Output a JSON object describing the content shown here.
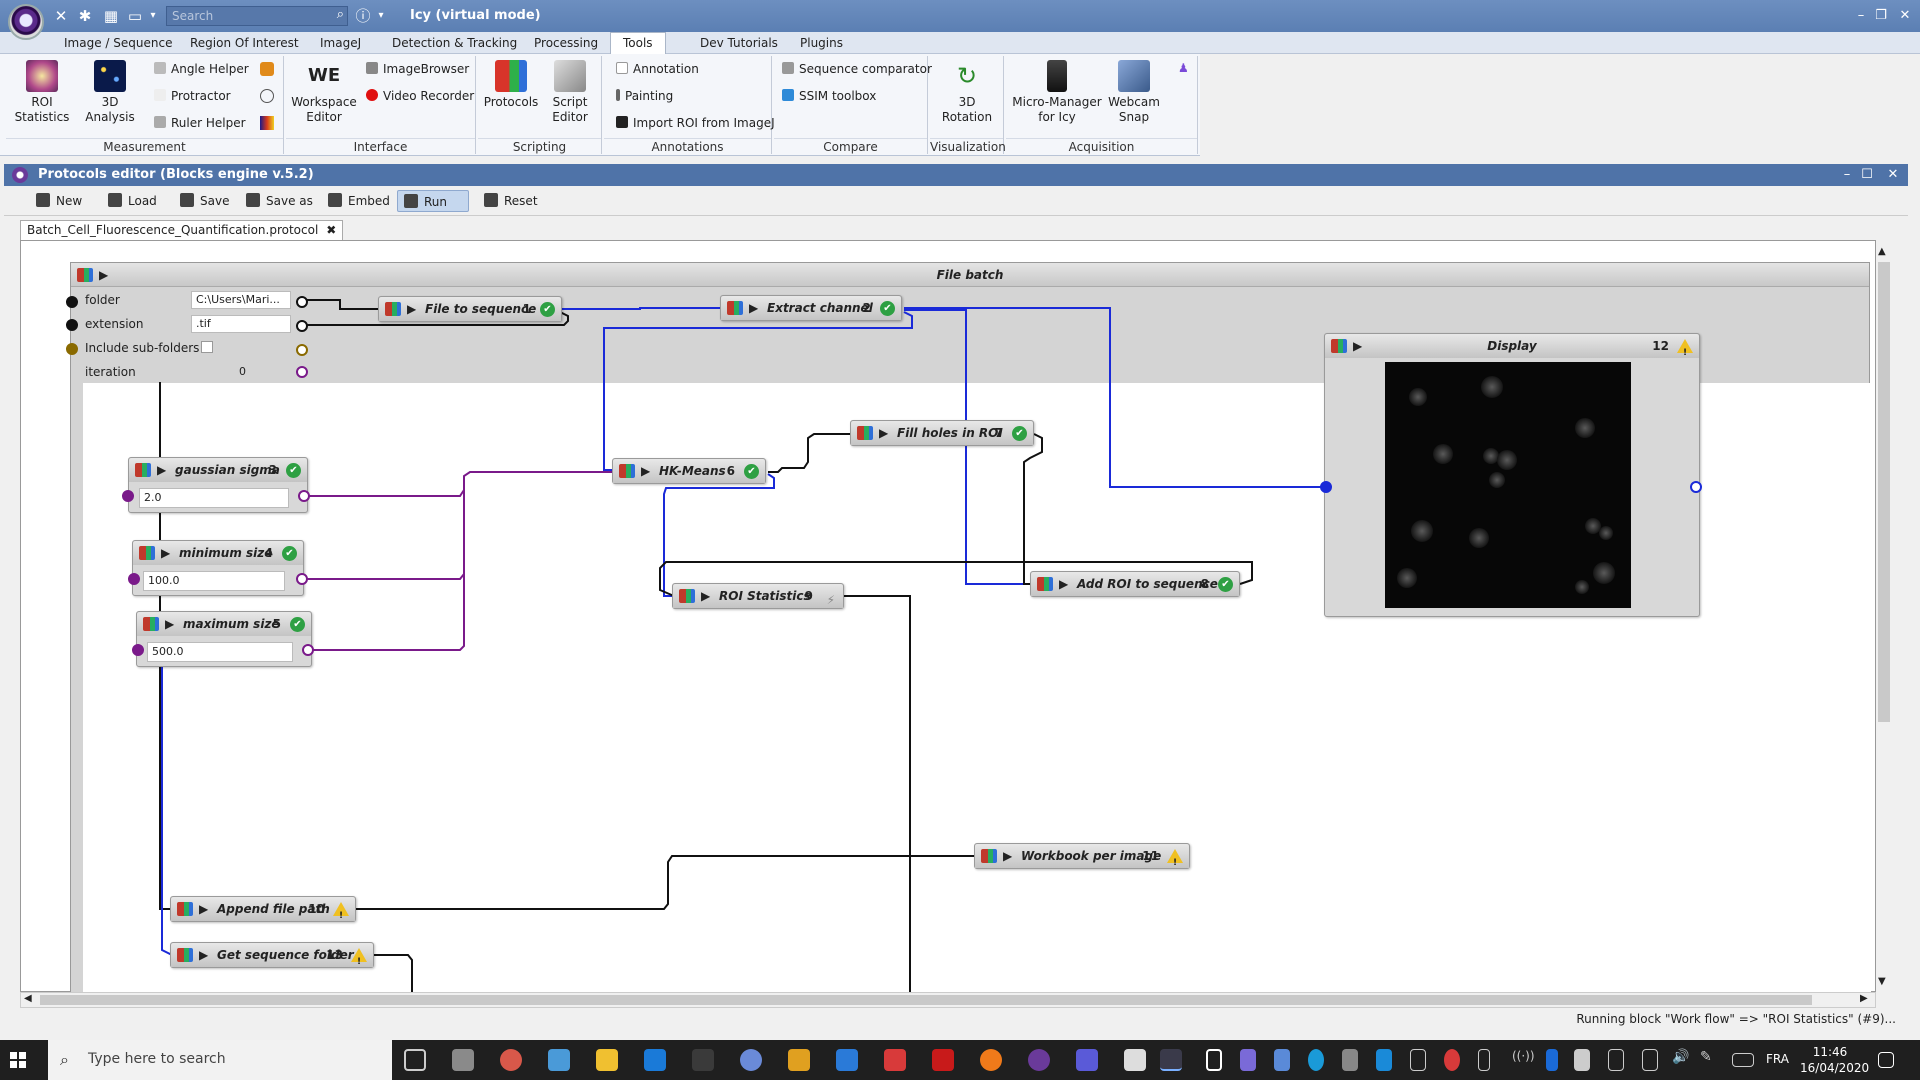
{
  "app": {
    "title": "Icy (virtual mode)",
    "search_placeholder": "Search"
  },
  "menu": {
    "tabs": [
      "Image / Sequence",
      "Region Of Interest",
      "ImageJ",
      "Detection & Tracking",
      "Processing",
      "Tools",
      "Dev Tutorials",
      "Plugins"
    ],
    "active": "Tools"
  },
  "ribbon": {
    "measurement": {
      "label": "Measurement",
      "roi_statistics": "ROI\nStatistics",
      "analysis_3d": "3D\nAnalysis",
      "angle_helper": "Angle Helper",
      "protractor": "Protractor",
      "ruler_helper": "Ruler Helper"
    },
    "interface": {
      "label": "Interface",
      "workspace_editor": "Workspace\nEditor",
      "image_browser": "ImageBrowser",
      "video_recorder": "Video Recorder"
    },
    "scripting": {
      "label": "Scripting",
      "protocols": "Protocols",
      "script_editor": "Script\nEditor"
    },
    "annotations": {
      "label": "Annotations",
      "annotation": "Annotation",
      "painting": "Painting",
      "import_roi": "Import ROI from ImageJ"
    },
    "compare": {
      "label": "Compare",
      "sequence_comparator": "Sequence comparator",
      "ssim_toolbox": "SSIM toolbox"
    },
    "visualization": {
      "label": "Visualization",
      "rotation_3d": "3D\nRotation"
    },
    "acquisition": {
      "label": "Acquisition",
      "micro_manager": "Micro-Manager\nfor Icy",
      "webcam_snap": "Webcam\nSnap"
    }
  },
  "protocols_editor": {
    "title": "Protocols editor (Blocks engine v.5.2)",
    "toolbar": {
      "new": "New",
      "load": "Load",
      "save": "Save",
      "save_as": "Save as",
      "embed": "Embed",
      "run": "Run",
      "reset": "Reset"
    },
    "doc_tab": "Batch_Cell_Fluorescence_Quantification.protocol",
    "status": "Running block \"Work flow\" => \"ROI Statistics\" (#9)..."
  },
  "file_batch": {
    "title": "File batch",
    "params": [
      {
        "label": "folder",
        "value": "C:\\Users\\Mari..."
      },
      {
        "label": "extension",
        "value": ".tif"
      },
      {
        "label": "Include sub-folders",
        "value": ""
      },
      {
        "label": "iteration",
        "value": "0"
      }
    ]
  },
  "blocks": [
    {
      "id": "b1",
      "name": "File to sequence",
      "num": "1",
      "status": "ok"
    },
    {
      "id": "b2",
      "name": "Extract channel",
      "num": "2",
      "status": "ok"
    },
    {
      "id": "b3",
      "name": "gaussian sigma",
      "num": "3",
      "status": "ok",
      "value": "2.0"
    },
    {
      "id": "b4",
      "name": "minimum size",
      "num": "4",
      "status": "ok",
      "value": "100.0"
    },
    {
      "id": "b5",
      "name": "maximum size",
      "num": "5",
      "status": "ok",
      "value": "500.0"
    },
    {
      "id": "b6",
      "name": "HK-Means",
      "num": "6",
      "status": "ok"
    },
    {
      "id": "b7",
      "name": "Fill holes in ROI",
      "num": "7",
      "status": "ok"
    },
    {
      "id": "b8",
      "name": "Add ROI to sequence",
      "num": "8",
      "status": "ok"
    },
    {
      "id": "b9",
      "name": "ROI Statistics",
      "num": "9",
      "status": "running"
    },
    {
      "id": "b10",
      "name": "Append file path",
      "num": "10",
      "status": "warn"
    },
    {
      "id": "b11",
      "name": "Workbook  per image",
      "num": "11",
      "status": "warn"
    },
    {
      "id": "b12",
      "name": "Display",
      "num": "12",
      "status": "warn"
    },
    {
      "id": "b13",
      "name": "Get sequence folder",
      "num": "13",
      "status": "warn"
    }
  ],
  "taskbar": {
    "search_placeholder": "Type here to search",
    "language": "FRA",
    "time": "11:46",
    "date": "16/04/2020"
  },
  "colors": {
    "titlebar": "#5b7fb3",
    "link_blue": "#1a2ad8",
    "link_purple": "#7a1a8a",
    "link_black": "#111111",
    "ok_green": "#2ea043",
    "warn_yellow": "#f0c020"
  }
}
